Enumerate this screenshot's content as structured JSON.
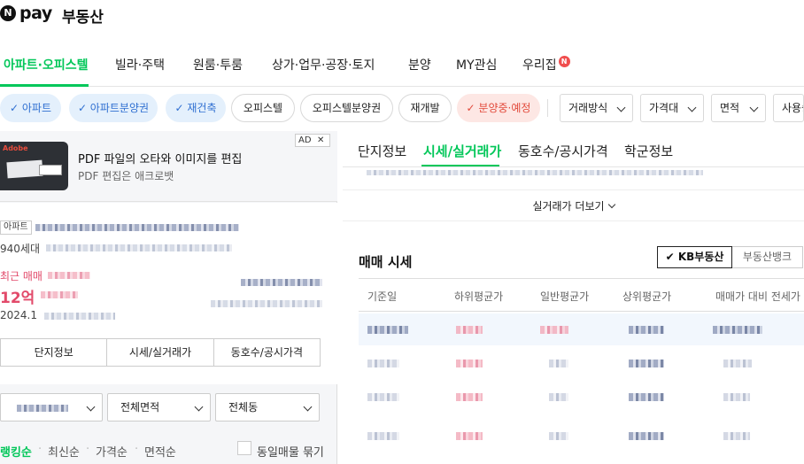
{
  "header": {
    "logo_mark": "N",
    "logo_pay": "pay",
    "logo_service": "부동산"
  },
  "nav": {
    "items": [
      {
        "label": "아파트·오피스텔",
        "active": true
      },
      {
        "label": "빌라·주택"
      },
      {
        "label": "원룸·투룸"
      },
      {
        "label": "상가·업무·공장·토지"
      },
      {
        "label": "분양"
      },
      {
        "label": "MY관심"
      },
      {
        "label": "우리집",
        "badge": "N"
      }
    ]
  },
  "filters": {
    "chips": [
      {
        "label": "✓ 아파트",
        "style": "blue"
      },
      {
        "label": "✓ 아파트분양권",
        "style": "blue"
      },
      {
        "label": "✓ 재건축",
        "style": "blue"
      },
      {
        "label": "오피스텔",
        "style": "plain"
      },
      {
        "label": "오피스텔분양권",
        "style": "plain"
      },
      {
        "label": "재개발",
        "style": "plain"
      },
      {
        "label": "✓ 분양중·예정",
        "style": "red"
      }
    ],
    "dropdowns": [
      "거래방식",
      "가격대",
      "면적",
      "사용승"
    ]
  },
  "ad": {
    "title": "PDF 파일의 오타와 이미지를 편집",
    "subtitle": "PDF 편집은 애크로뱃",
    "badge": "AD",
    "close": "✕",
    "brand": "Adobe"
  },
  "complex": {
    "tag": "아파트",
    "households_prefix": "940세대",
    "recent_label": "최근 매매",
    "price": "12억",
    "date_prefix": "2024.1",
    "buttons": [
      "단지정보",
      "시세/실거래가",
      "동호수/공시가격"
    ]
  },
  "list_filters": {
    "select1": "",
    "select2": "전체면적",
    "select3": "전체동"
  },
  "sort": {
    "options": [
      "랭킹순",
      "최신순",
      "가격순",
      "면적순"
    ],
    "same_listing_label": "동일매물 묶기"
  },
  "detail": {
    "tabs": [
      "단지정보",
      "시세/실거래가",
      "동호수/공시가격",
      "학군정보"
    ],
    "active_tab": 1,
    "more_label": "실거래가 더보기",
    "section_title": "매매 시세",
    "source_buttons": [
      "KB부동산",
      "부동산뱅크"
    ],
    "columns": [
      "기준일",
      "하위평균가",
      "일반평균가",
      "상위평균가",
      "매매가 대비 전세가"
    ]
  }
}
